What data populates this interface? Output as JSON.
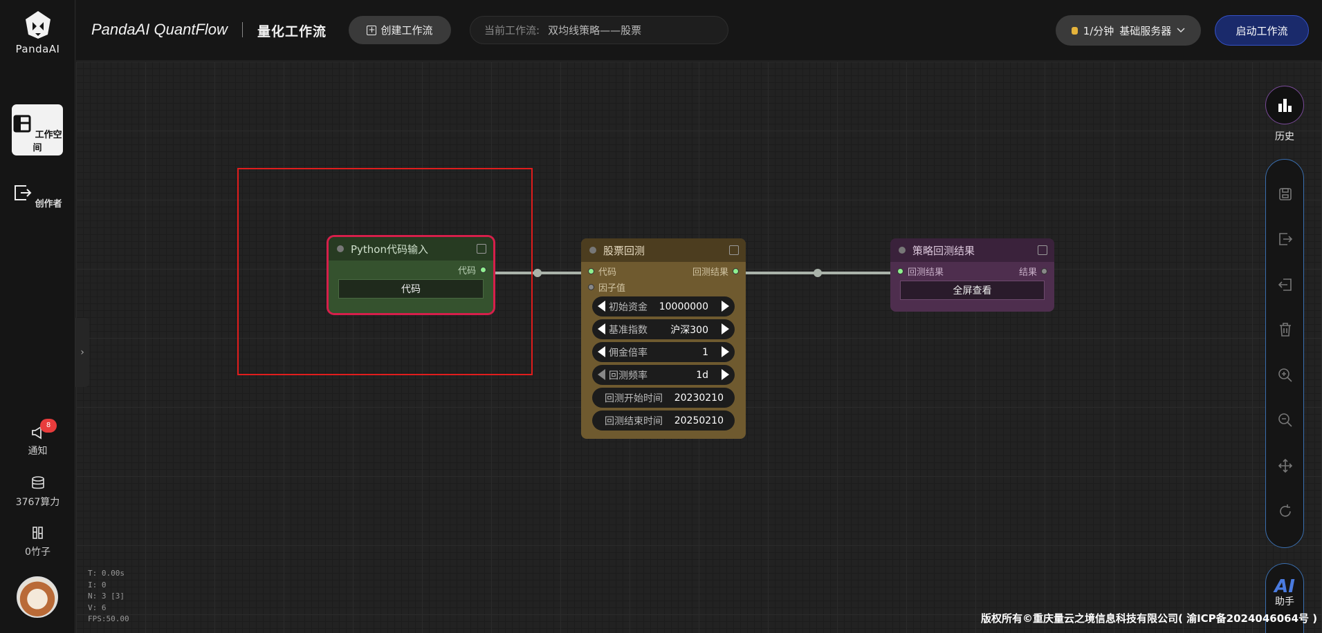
{
  "brand": {
    "logo_text": "PandaAI",
    "app_name": "PandaAI QuantFlow",
    "subtitle": "量化工作流"
  },
  "sidebar": {
    "items": [
      {
        "label": "工作空间",
        "icon": "workspace-icon",
        "active": true
      },
      {
        "label": "创作者",
        "icon": "creator-exit-icon",
        "active": false
      }
    ],
    "bottom": [
      {
        "label": "通知",
        "icon": "megaphone-icon",
        "badge": "8"
      },
      {
        "label": "3767算力",
        "icon": "database-icon"
      },
      {
        "label": "0竹子",
        "icon": "bamboo-icon"
      }
    ]
  },
  "header": {
    "create_label": "创建工作流",
    "current_label": "当前工作流:",
    "current_value": "双均线策略——股票",
    "server_rate": "1/分钟",
    "server_name": "基础服务器",
    "start_label": "启动工作流"
  },
  "nodes": {
    "python": {
      "title": "Python代码输入",
      "output": "代码",
      "button": "代码"
    },
    "backtest": {
      "title": "股票回测",
      "inputs": [
        "代码",
        "因子值"
      ],
      "output": "回测结果",
      "widgets": [
        {
          "label": "初始资金",
          "value": "10000000"
        },
        {
          "label": "基准指数",
          "value": "沪深300"
        },
        {
          "label": "佣金倍率",
          "value": "1"
        },
        {
          "label": "回测频率",
          "value": "1d"
        },
        {
          "label": "回测开始时间",
          "value": "20230210"
        },
        {
          "label": "回测结束时间",
          "value": "20250210"
        }
      ]
    },
    "result": {
      "title": "策略回测结果",
      "input": "回测结果",
      "output": "结果",
      "button": "全屏查看"
    }
  },
  "toolbar": {
    "history_label": "历史",
    "ai_text": "AI",
    "ai_label": "助手"
  },
  "stats": {
    "t": "T: 0.00s",
    "i": "I: 0",
    "n": "N: 3 [3]",
    "v": "V: 6",
    "fps": "FPS:50.00"
  },
  "footer": {
    "copyright": "版权所有©重庆量云之境信息科技有限公司( 渝ICP备2024046064号 )"
  },
  "colors": {
    "accent": "#3552c9",
    "selection": "#e11d1d",
    "python_node": "#35522e",
    "backtest_node": "#6f5a2f",
    "result_node": "#4e2e4e"
  }
}
